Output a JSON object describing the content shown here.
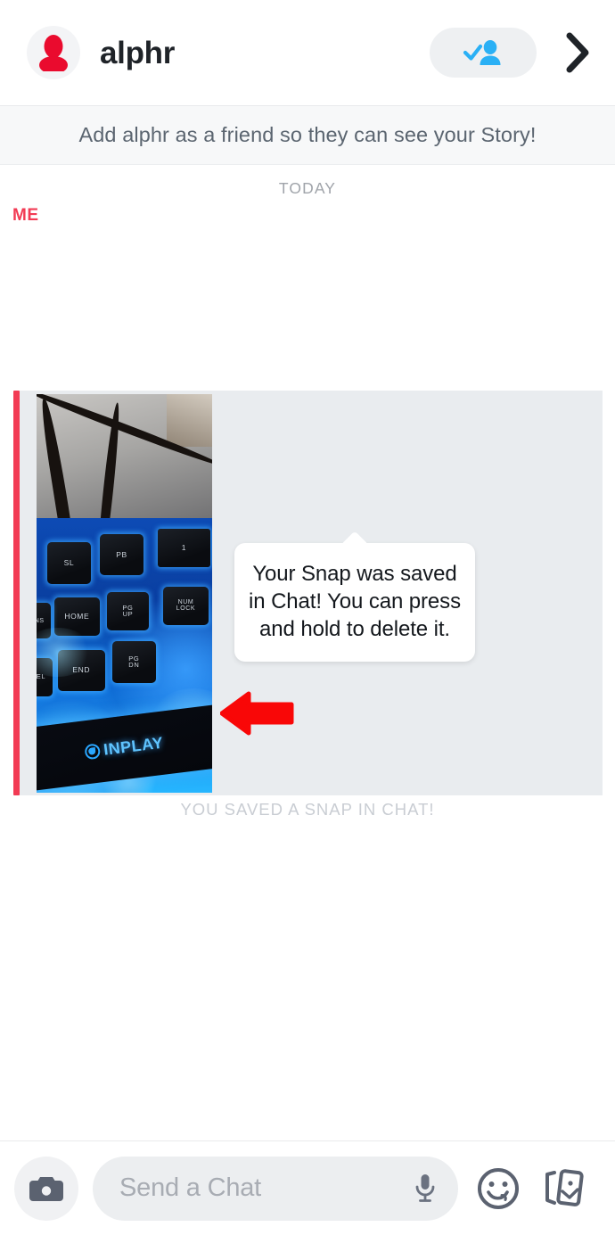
{
  "header": {
    "avatar_icon": "person-silhouette-icon",
    "avatar_color": "#ea0b2e",
    "title": "alphr",
    "add_friend_icon": "add-friend-check-icon",
    "add_friend_icon_color": "#2ab0f5",
    "chevron_icon": "chevron-right-icon"
  },
  "banner": {
    "text": "Add alphr as a friend so they can see your Story!"
  },
  "conversation": {
    "day_divider": "TODAY",
    "sender_label": "ME",
    "sender_color": "#f23b54",
    "snap": {
      "thumbnail_alt": "blue backlit mechanical keyboard snap",
      "keys": [
        "SL",
        "PB",
        "1",
        "HOME",
        "PG UP",
        "NUM LOCK",
        "END",
        "PG DN",
        "DEL",
        "INS"
      ],
      "brand_text": "INPLAY"
    },
    "status_text": "YOU SAVED A SNAP IN CHAT!"
  },
  "tooltip": {
    "text": "Your Snap was saved in Chat! You can press and hold to delete it."
  },
  "annotation": {
    "arrow_icon": "red-left-arrow-icon",
    "arrow_color": "#f90707"
  },
  "composer": {
    "camera_icon": "camera-icon",
    "input_placeholder": "Send a Chat",
    "input_value": "",
    "mic_icon": "microphone-icon",
    "sticker_icon": "smiley-face-icon",
    "cards_icon": "snap-cards-icon"
  }
}
